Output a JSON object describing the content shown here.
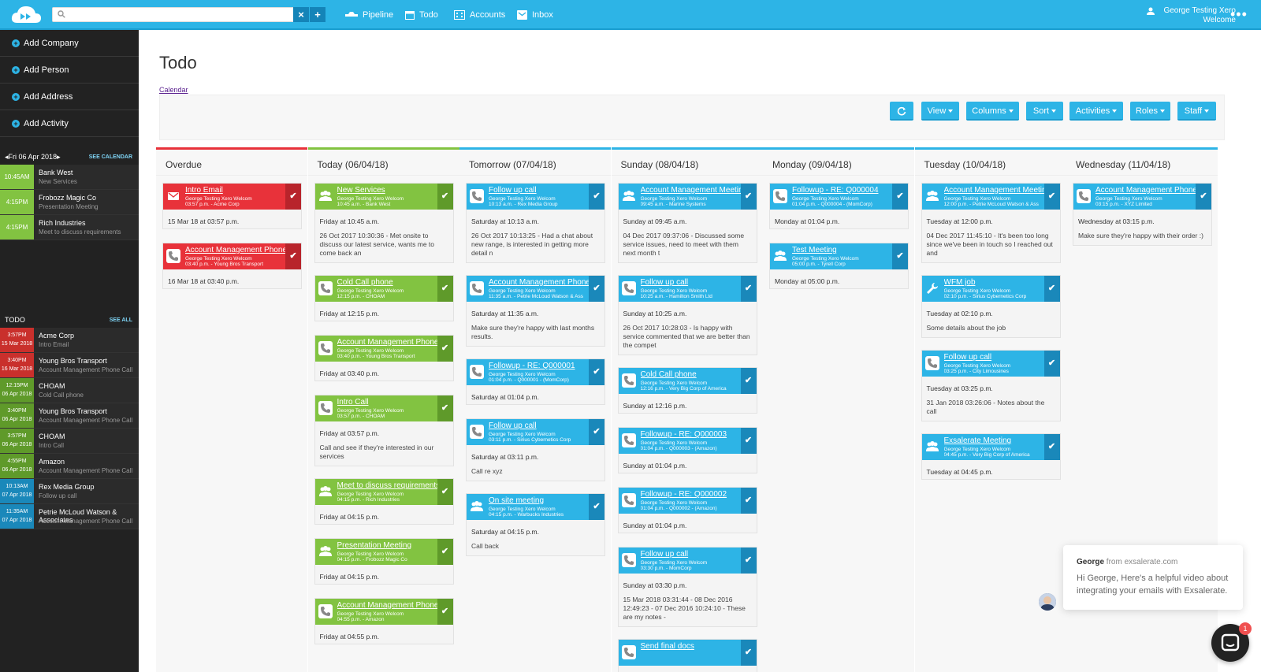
{
  "colors": {
    "accent": "#2db4e6",
    "overdue": "#e8323a",
    "today": "#82c341"
  },
  "topbar": {
    "search_placeholder": "",
    "nav": [
      {
        "label": "Pipeline",
        "icon": "pipeline-icon"
      },
      {
        "label": "Todo",
        "icon": "calendar-icon"
      },
      {
        "label": "Accounts",
        "icon": "building-icon"
      },
      {
        "label": "Inbox",
        "icon": "envelope-icon"
      }
    ],
    "user_name": "George Testing Xero",
    "user_greeting": "Welcome",
    "more": "•••"
  },
  "sidebar": {
    "actions": [
      {
        "label": "Add Company"
      },
      {
        "label": "Add Person"
      },
      {
        "label": "Add Address"
      },
      {
        "label": "Add Activity"
      }
    ],
    "date": "Fri 06 Apr 2018",
    "see_calendar": "SEE CALENDAR",
    "calendar_items": [
      {
        "time": "10:45AM",
        "title": "Bank West",
        "sub": "New Services",
        "color": "#82c341"
      },
      {
        "time": "4:15PM",
        "title": "Frobozz Magic Co",
        "sub": "Presentation Meeting",
        "color": "#82c341"
      },
      {
        "time": "4:15PM",
        "title": "Rich Industries",
        "sub": "Meet to discuss requirements",
        "color": "#82c341"
      }
    ],
    "todo_label": "TODO",
    "see_all": "SEE ALL",
    "todo_items": [
      {
        "time": "3:57PM",
        "date": "15 Mar 2018",
        "title": "Acme Corp",
        "sub": "Intro Email",
        "color": "#c9302c"
      },
      {
        "time": "3:40PM",
        "date": "16 Mar 2018",
        "title": "Young Bros Transport",
        "sub": "Account Management Phone Call",
        "color": "#c9302c"
      },
      {
        "time": "12:15PM",
        "date": "06 Apr 2018",
        "title": "CHOAM",
        "sub": "Cold Call phone",
        "color": "#5f9a2a"
      },
      {
        "time": "3:40PM",
        "date": "06 Apr 2018",
        "title": "Young Bros Transport",
        "sub": "Account Management Phone Call",
        "color": "#5f9a2a"
      },
      {
        "time": "3:57PM",
        "date": "06 Apr 2018",
        "title": "CHOAM",
        "sub": "Intro Call",
        "color": "#5f9a2a"
      },
      {
        "time": "4:55PM",
        "date": "06 Apr 2018",
        "title": "Amazon",
        "sub": "Account Management Phone Call",
        "color": "#5f9a2a"
      },
      {
        "time": "10:13AM",
        "date": "07 Apr 2018",
        "title": "Rex Media Group",
        "sub": "Follow up call",
        "color": "#1a88ba"
      },
      {
        "time": "11:35AM",
        "date": "07 Apr 2018",
        "title": "Petrie McLoud Watson & Associates",
        "sub": "Account Management Phone Call",
        "color": "#1a88ba"
      }
    ]
  },
  "main": {
    "title": "Todo",
    "calendar_link": "Calendar",
    "toolbar": [
      "View",
      "Columns",
      "Sort",
      "Activities",
      "Roles",
      "Staff"
    ],
    "columns": [
      {
        "header": "Overdue",
        "color": "#e8323a",
        "cards": [
          {
            "type": "email",
            "title": "Intro Email",
            "sub1": "George Testing Xero Welcom",
            "sub2": "03:57 p.m. - Acme Corp",
            "when": "15 Mar 18 at 03:57 p.m.",
            "note": ""
          },
          {
            "type": "phone",
            "title": "Account Management Phone Call",
            "sub1": "George Testing Xero Welcom",
            "sub2": "03:40 p.m. - Young Bros Transport",
            "when": "16 Mar 18 at 03:40 p.m.",
            "note": ""
          }
        ]
      },
      {
        "header": "Today (06/04/18)",
        "color": "#82c341",
        "cards": [
          {
            "type": "group",
            "title": "New Services",
            "sub1": "George Testing Xero Welcom",
            "sub2": "10:45 a.m. - Bank West",
            "when": "Friday at 10:45 a.m.",
            "note": "26 Oct 2017 10:30:36 - Met onsite to discuss our latest service, wants me to come back an"
          },
          {
            "type": "phone",
            "title": "Cold Call phone",
            "sub1": "George Testing Xero Welcom",
            "sub2": "12:15 p.m. - CHOAM",
            "when": "Friday at 12:15 p.m.",
            "note": ""
          },
          {
            "type": "phone",
            "title": "Account Management Phone Call",
            "sub1": "George Testing Xero Welcom",
            "sub2": "03:40 p.m. - Young Bros Transport",
            "when": "Friday at 03:40 p.m.",
            "note": ""
          },
          {
            "type": "phone",
            "title": "Intro Call",
            "sub1": "George Testing Xero Welcom",
            "sub2": "03:57 p.m. - CHOAM",
            "when": "Friday at 03:57 p.m.",
            "note": "Call and see if they're interested in our services"
          },
          {
            "type": "group",
            "title": "Meet to discuss requirements",
            "sub1": "George Testing Xero Welcom",
            "sub2": "04:15 p.m. - Rich Industries",
            "when": "Friday at 04:15 p.m.",
            "note": ""
          },
          {
            "type": "group",
            "title": "Presentation Meeting",
            "sub1": "George Testing Xero Welcom",
            "sub2": "04:15 p.m. - Frobozz Magic Co",
            "when": "Friday at 04:15 p.m.",
            "note": ""
          },
          {
            "type": "phone",
            "title": "Account Management Phone Call",
            "sub1": "George Testing Xero Welcom",
            "sub2": "04:55 p.m. - Amazon",
            "when": "Friday at 04:55 p.m.",
            "note": ""
          }
        ]
      },
      {
        "header": "Tomorrow (07/04/18)",
        "color": "#2db4e6",
        "cards": [
          {
            "type": "phone",
            "title": "Follow up call",
            "sub1": "George Testing Xero Welcom",
            "sub2": "10:13 a.m. - Rex Media Group",
            "when": "Saturday at 10:13 a.m.",
            "note": "26 Oct 2017 10:13:25 - Had a chat about new range, is interested in getting more detail n"
          },
          {
            "type": "phone",
            "title": "Account Management Phone Call",
            "sub1": "George Testing Xero Welcom",
            "sub2": "11:35 a.m. - Petrie McLoud Watson & Ass",
            "when": "Saturday at 11:35 a.m.",
            "note": "Make sure they're happy with last months results."
          },
          {
            "type": "phone",
            "title": "Followup - RE: Q000001",
            "sub1": "George Testing Xero Welcom",
            "sub2": "01:04 p.m. - Q000001 - (MomCorp)",
            "when": "Saturday at 01:04 p.m.",
            "note": ""
          },
          {
            "type": "phone",
            "title": "Follow up call",
            "sub1": "George Testing Xero Welcom",
            "sub2": "03:11 p.m. - Sirius Cybernetics Corp",
            "when": "Saturday at 03:11 p.m.",
            "note": "Call re xyz"
          },
          {
            "type": "group",
            "title": "On site meeting",
            "sub1": "George Testing Xero Welcom",
            "sub2": "04:15 p.m. - Warbucks Industries",
            "when": "Saturday at 04:15 p.m.",
            "note": "Call back"
          }
        ]
      },
      {
        "header": "Sunday (08/04/18)",
        "color": "#2db4e6",
        "cards": [
          {
            "type": "group",
            "title": "Account Management Meeting",
            "sub1": "George Testing Xero Welcom",
            "sub2": "09:45 a.m. - Marine Systems",
            "when": "Sunday at 09:45 a.m.",
            "note": "04 Dec 2017 09:37:06 - Discussed some service issues, need to meet with them next month t"
          },
          {
            "type": "phone",
            "title": "Follow up call",
            "sub1": "George Testing Xero Welcom",
            "sub2": "10:25 a.m. - Hamilton Smith Ltd",
            "when": "Sunday at 10:25 a.m.",
            "note": "26 Oct 2017 10:28:03 - Is happy with service commented that we are better than the compet"
          },
          {
            "type": "phone",
            "title": "Cold Call phone",
            "sub1": "George Testing Xero Welcom",
            "sub2": "12:16 p.m. - Very Big Corp of America",
            "when": "Sunday at 12:16 p.m.",
            "note": ""
          },
          {
            "type": "phone",
            "title": "Followup - RE: Q000003",
            "sub1": "George Testing Xero Welcom",
            "sub2": "01:04 p.m. - Q000003 - (Amazon)",
            "when": "Sunday at 01:04 p.m.",
            "note": ""
          },
          {
            "type": "phone",
            "title": "Followup - RE: Q000002",
            "sub1": "George Testing Xero Welcom",
            "sub2": "01:04 p.m. - Q000002 - (Amazon)",
            "when": "Sunday at 01:04 p.m.",
            "note": ""
          },
          {
            "type": "phone",
            "title": "Follow up call",
            "sub1": "George Testing Xero Welcom",
            "sub2": "03:30 p.m. - MomCorp",
            "when": "Sunday at 03:30 p.m.",
            "note": "15 Mar 2018 03:31:44 - 08 Dec 2016 12:49:23 - 07 Dec 2016 10:24:10 - These are my notes -"
          },
          {
            "type": "phone",
            "title": "Send final docs",
            "sub1": "",
            "sub2": "",
            "when": "",
            "note": ""
          }
        ]
      },
      {
        "header": "Monday (09/04/18)",
        "color": "#2db4e6",
        "cards": [
          {
            "type": "phone",
            "title": "Followup - RE: Q000004",
            "sub1": "George Testing Xero Welcom",
            "sub2": "01:04 p.m. - Q000004 - (MomCorp)",
            "when": "Monday at 01:04 p.m.",
            "note": ""
          },
          {
            "type": "group",
            "title": "Test Meeting",
            "sub1": "George Testing Xero Welcom",
            "sub2": "05:00 p.m. - Tyrell Corp",
            "when": "Monday at 05:00 p.m.",
            "note": ""
          }
        ]
      },
      {
        "header": "Tuesday (10/04/18)",
        "color": "#2db4e6",
        "cards": [
          {
            "type": "group",
            "title": "Account Management Meeting",
            "sub1": "George Testing Xero Welcom",
            "sub2": "12:00 p.m. - Petrie McLoud Watson & Ass",
            "when": "Tuesday at 12:00 p.m.",
            "note": "04 Dec 2017 11:45:10 - It's been too long since we've been in touch so I reached out and"
          },
          {
            "type": "wrench",
            "title": "WFM job",
            "sub1": "George Testing Xero Welcom",
            "sub2": "02:10 p.m. - Sirius Cybernetics Corp",
            "when": "Tuesday at 02:10 p.m.",
            "note": "Some details about the job"
          },
          {
            "type": "phone",
            "title": "Follow up call",
            "sub1": "George Testing Xero Welcom",
            "sub2": "03:25 p.m. - City Limousines",
            "when": "Tuesday at 03:25 p.m.",
            "note": "31 Jan 2018 03:26:06 - Notes about the call"
          },
          {
            "type": "group",
            "title": "Exsalerate Meeting",
            "sub1": "George Testing Xero Welcom",
            "sub2": "04:45 p.m. - Very Big Corp of America",
            "when": "Tuesday at 04:45 p.m.",
            "note": ""
          }
        ]
      },
      {
        "header": "Wednesday (11/04/18)",
        "color": "#2db4e6",
        "cards": [
          {
            "type": "phone",
            "title": "Account Management Phone Call",
            "sub1": "George Testing Xero Welcom",
            "sub2": "03:15 p.m. - XYZ Limited",
            "when": "Wednesday at 03:15 p.m.",
            "note": "Make sure they're happy with their order :)"
          }
        ]
      }
    ]
  },
  "chat": {
    "from_name": "George",
    "from_suffix": "from exsalerate.com",
    "message": "Hi George, Here's a helpful video about integrating your emails with Exsalerate.",
    "badge": "1"
  }
}
